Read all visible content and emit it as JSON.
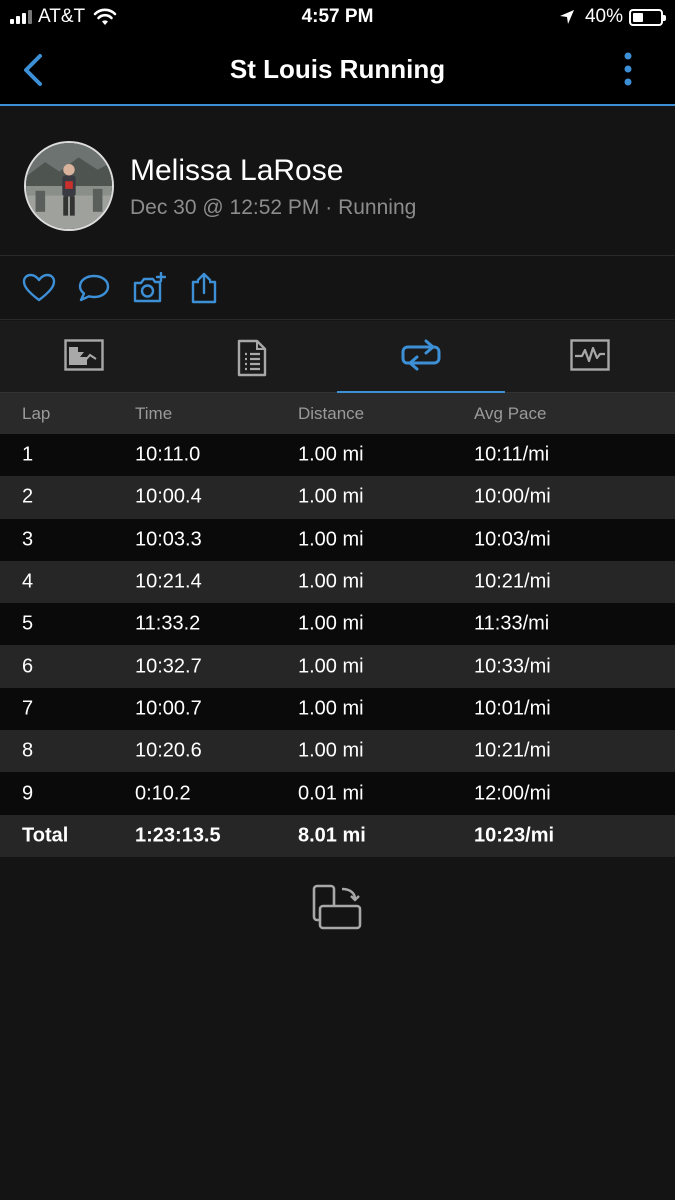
{
  "status_bar": {
    "carrier": "AT&T",
    "time": "4:57 PM",
    "battery": "40%"
  },
  "nav": {
    "title": "St Louis Running",
    "icons": [
      "chevron-left-icon",
      "more-vertical-icon"
    ]
  },
  "profile": {
    "name": "Melissa LaRose",
    "meta": "Dec 30 @ 12:52 PM · Running"
  },
  "actions": [
    "heart-icon",
    "comment-icon",
    "add-photo-icon",
    "share-icon"
  ],
  "tabs": [
    "overview-icon",
    "details-icon",
    "laps-icon",
    "charts-icon"
  ],
  "active_tab": 2,
  "laps": {
    "headers": {
      "lap": "Lap",
      "time": "Time",
      "distance": "Distance",
      "pace": "Avg Pace"
    },
    "rows": [
      {
        "lap": "1",
        "time": "10:11.0",
        "distance": "1.00 mi",
        "pace": "10:11/mi"
      },
      {
        "lap": "2",
        "time": "10:00.4",
        "distance": "1.00 mi",
        "pace": "10:00/mi"
      },
      {
        "lap": "3",
        "time": "10:03.3",
        "distance": "1.00 mi",
        "pace": "10:03/mi"
      },
      {
        "lap": "4",
        "time": "10:21.4",
        "distance": "1.00 mi",
        "pace": "10:21/mi"
      },
      {
        "lap": "5",
        "time": "11:33.2",
        "distance": "1.00 mi",
        "pace": "11:33/mi"
      },
      {
        "lap": "6",
        "time": "10:32.7",
        "distance": "1.00 mi",
        "pace": "10:33/mi"
      },
      {
        "lap": "7",
        "time": "10:00.7",
        "distance": "1.00 mi",
        "pace": "10:01/mi"
      },
      {
        "lap": "8",
        "time": "10:20.6",
        "distance": "1.00 mi",
        "pace": "10:21/mi"
      },
      {
        "lap": "9",
        "time": "0:10.2",
        "distance": "0.01 mi",
        "pace": "12:00/mi"
      }
    ],
    "total": {
      "label": "Total",
      "time": "1:23:13.5",
      "distance": "8.01 mi",
      "pace": "10:23/mi"
    }
  },
  "colors": {
    "accent": "#3d8fd6",
    "background": "#141414",
    "muted_text": "#8c8c8c"
  }
}
